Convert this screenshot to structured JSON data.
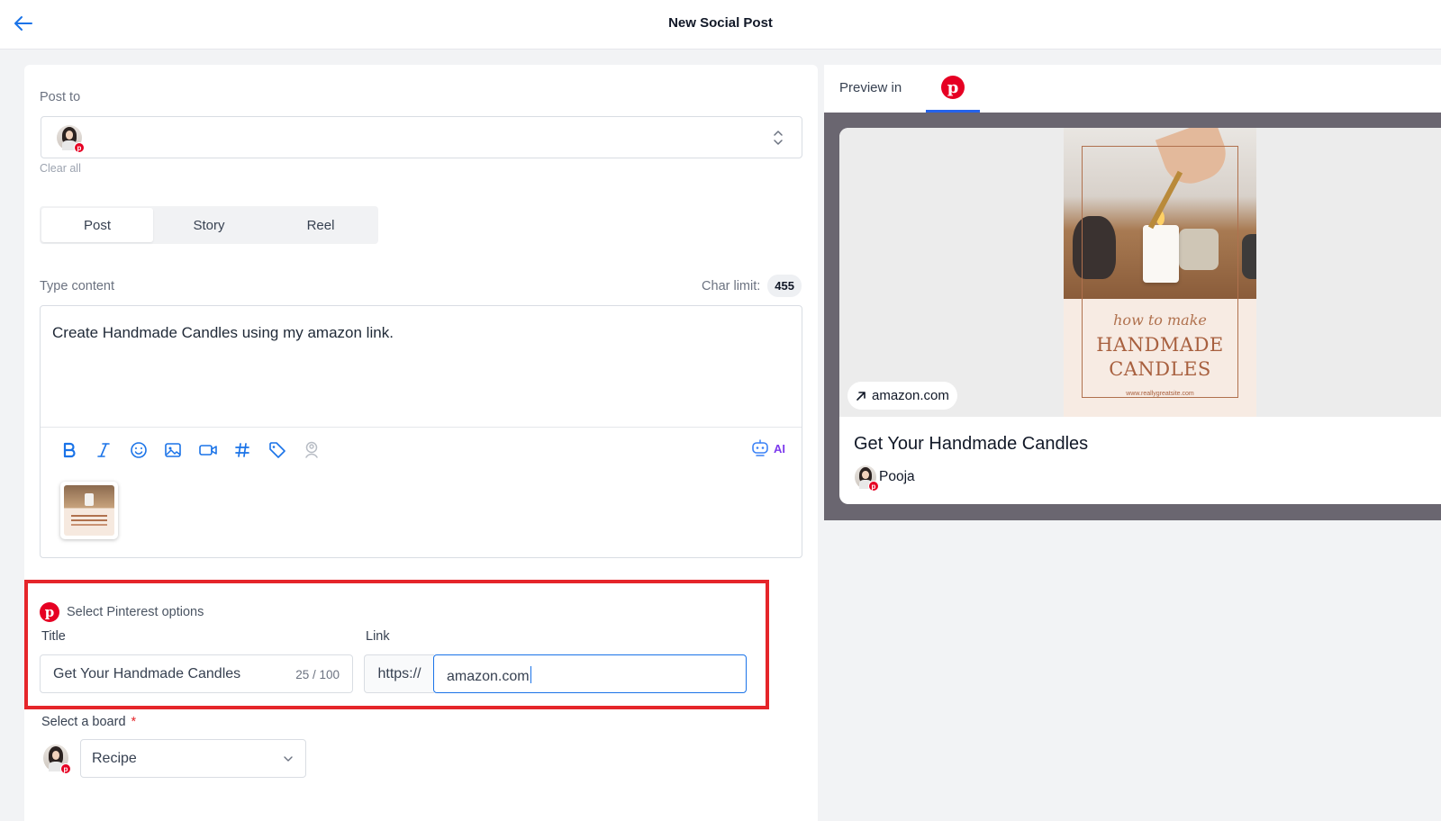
{
  "header": {
    "title": "New Social Post"
  },
  "composer": {
    "post_to_label": "Post to",
    "clear_all": "Clear all",
    "post_types": [
      "Post",
      "Story",
      "Reel"
    ],
    "active_post_type": "Post",
    "content_label": "Type content",
    "char_limit_label": "Char limit:",
    "char_limit_value": "455",
    "content_text": "Create Handmade Candles using my amazon link.",
    "ai_label": "AI",
    "toolbar_icons": [
      "bold-icon",
      "italic-icon",
      "emoji-icon",
      "image-icon",
      "video-icon",
      "hashtag-icon",
      "tag-icon",
      "location-icon"
    ]
  },
  "pinterest_options": {
    "heading": "Select Pinterest options",
    "title_label": "Title",
    "title_value": "Get Your Handmade Candles",
    "title_count": "25 / 100",
    "link_label": "Link",
    "link_prefix": "https://",
    "link_value": "amazon.com",
    "highlight_color": "#e5252a"
  },
  "board": {
    "label": "Select a board",
    "required_mark": "*",
    "value": "Recipe"
  },
  "preview": {
    "label": "Preview in",
    "network": "pinterest",
    "link_chip": "amazon.com",
    "image_script": "how to make",
    "image_title_line1": "HANDMADE",
    "image_title_line2": "CANDLES",
    "image_site": "www.reallygreatsite.com",
    "pin_title": "Get Your Handmade Candles",
    "author": "Pooja"
  },
  "colors": {
    "accent": "#1a73e8",
    "pinterest": "#e60023",
    "ai": "#7c3aed"
  }
}
